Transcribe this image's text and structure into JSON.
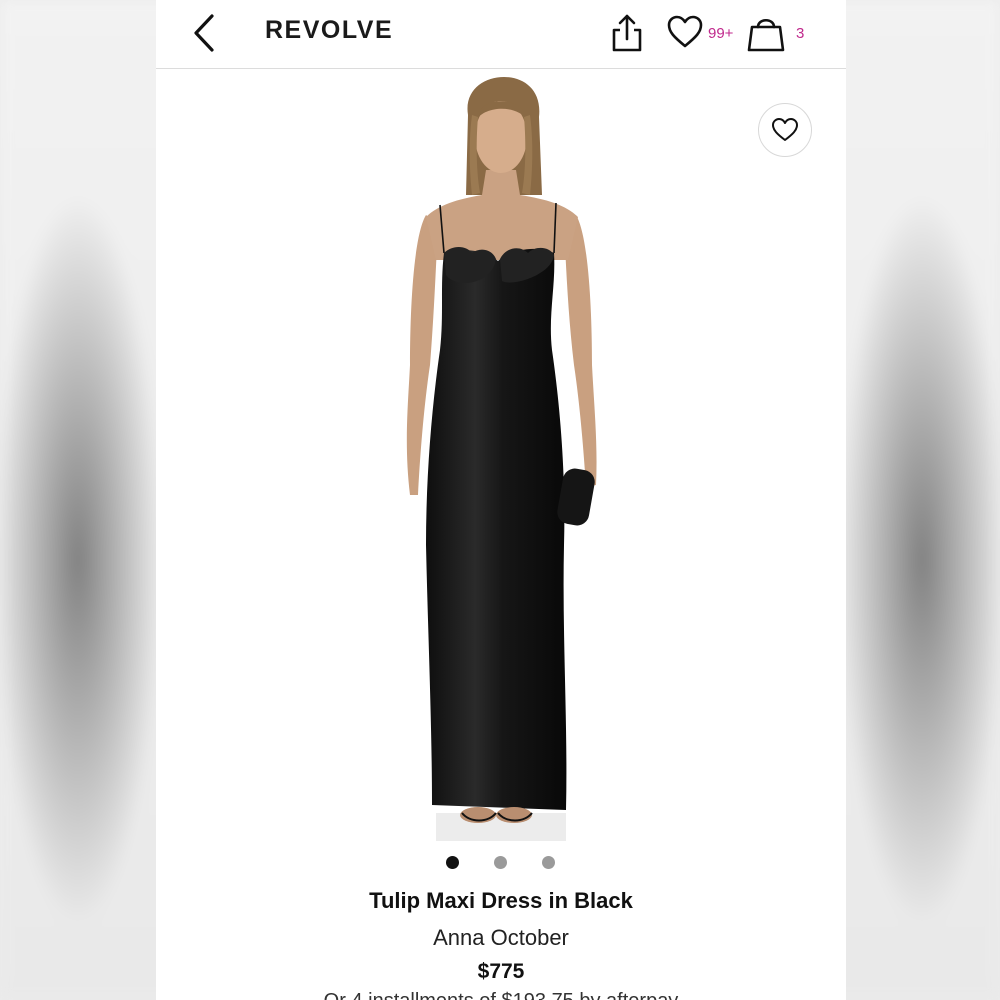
{
  "header": {
    "brand_logo": "REVOLVE",
    "wishlist_count": "99+",
    "bag_count": "3",
    "accent_color": "#c0288c"
  },
  "icons": {
    "back": "chevron-left-icon",
    "share": "share-icon",
    "wishlist": "heart-icon",
    "bag": "shopping-bag-icon",
    "favorite": "heart-icon"
  },
  "gallery": {
    "image_count": 3,
    "active_index": 0
  },
  "product": {
    "name": "Tulip Maxi Dress in Black",
    "brand": "Anna October",
    "price": "$775",
    "installments": "Or 4 installments of $193.75 by afterpay"
  }
}
